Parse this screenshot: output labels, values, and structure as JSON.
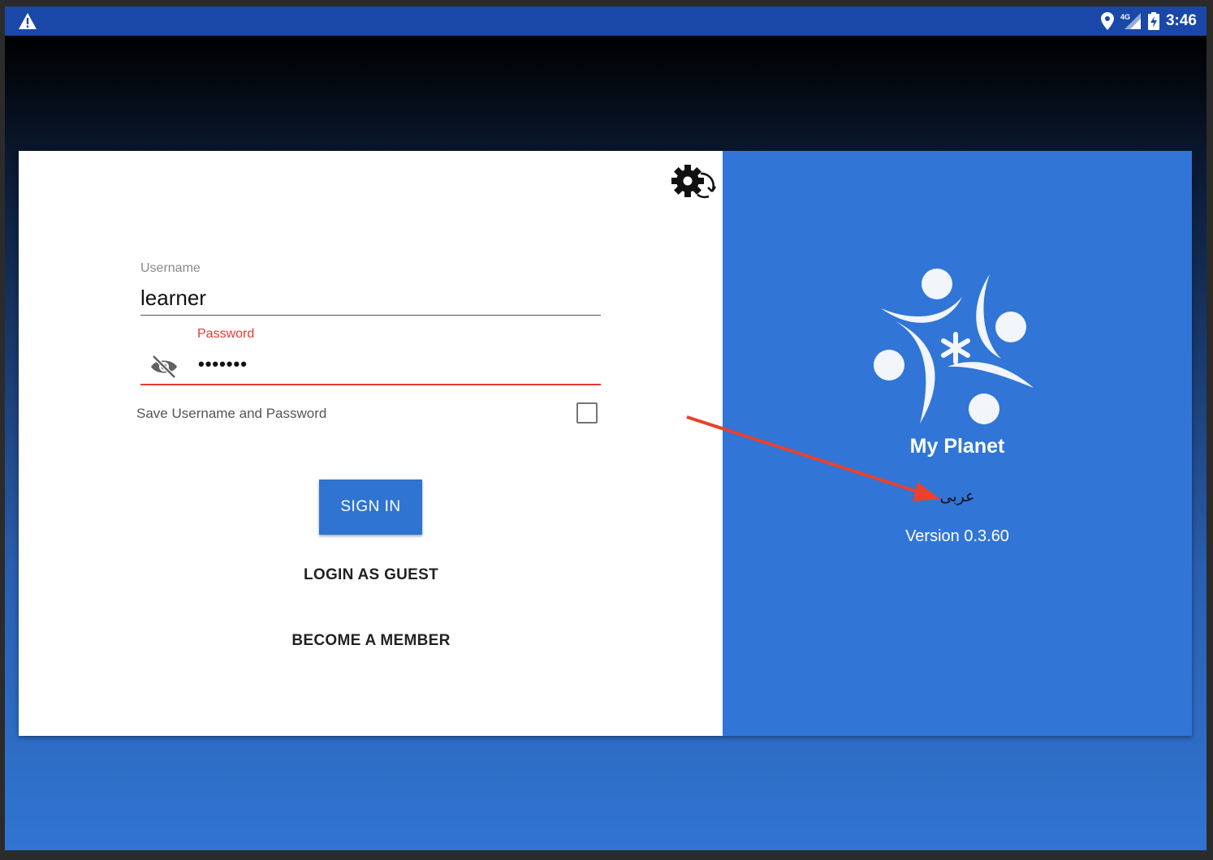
{
  "status_bar": {
    "time": "3:46",
    "network": "4G",
    "icons": [
      "warning-icon",
      "location-icon",
      "signal-icon",
      "battery-charging-icon"
    ]
  },
  "login": {
    "username_label": "Username",
    "username_value": "learner",
    "password_label": "Password",
    "password_value": "•••••••",
    "save_label": "Save Username and Password",
    "save_checked": false,
    "signin_label": "SIGN IN",
    "guest_label": "LOGIN AS GUEST",
    "member_label": "BECOME A MEMBER",
    "settings_icon": "settings-sync-icon",
    "visibility_icon": "eye-off-icon"
  },
  "brand": {
    "app_name": "My Planet",
    "language": "عربى",
    "version": "Version 0.3.60",
    "logo_icon": "my-planet-logo"
  },
  "colors": {
    "status_bar": "#1a48a8",
    "primary": "#3176d6",
    "error": "#e53935",
    "annotation_arrow": "#e8412c"
  }
}
